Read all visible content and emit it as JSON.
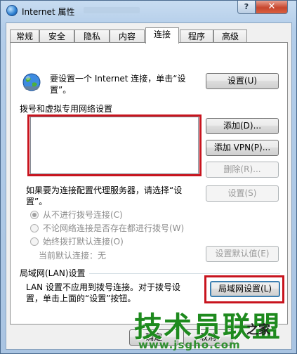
{
  "window": {
    "title": "Internet 属性",
    "help_label": "?",
    "close_label": "✕"
  },
  "tabs": [
    {
      "label": "常规"
    },
    {
      "label": "安全"
    },
    {
      "label": "隐私"
    },
    {
      "label": "内容"
    },
    {
      "label": "连接",
      "active": true
    },
    {
      "label": "程序"
    },
    {
      "label": "高级"
    }
  ],
  "setup": {
    "icon": "globe-network-icon",
    "text_line1": "要设置一个 Internet 连接，单击“设",
    "text_line2": "置”。",
    "button_label": "设置(U)"
  },
  "dialup": {
    "section_title": "拨号和虚拟专用网络设置",
    "add_button": "添加(D)...",
    "add_vpn_button": "添加 VPN(P)...",
    "delete_button": "删除(R)...",
    "proxy_text_line1": "如果要为连接配置代理服务器，请选择“设",
    "proxy_text_line2": "置”。",
    "settings_button": "设置(S)",
    "radio_never": "从不进行拨号连接(C)",
    "radio_no_network": "不论网络连接是否存在都进行拨号(W)",
    "radio_always": "始终拨打默认连接(O)",
    "current_default_label": "当前默认连接：",
    "current_default_value": "无",
    "set_default_button": "设置默认值(E)"
  },
  "lan": {
    "section_title": "局域网(LAN)设置",
    "text_line1": "LAN 设置不应用到拨号连接。对于拨号设",
    "text_line2": "置，单击上面的“设置”按钮。",
    "button_label": "局域网设置(L)"
  },
  "bottom": {
    "ok_button": "确定",
    "cancel_button": "取消"
  },
  "watermark": {
    "big_text": "技术员联盟",
    "suffix_text": "之家",
    "url_text": "www.jsgho.com"
  },
  "colors": {
    "highlight_red": "#c8141e",
    "watermark_green": "#1e8a1e"
  }
}
